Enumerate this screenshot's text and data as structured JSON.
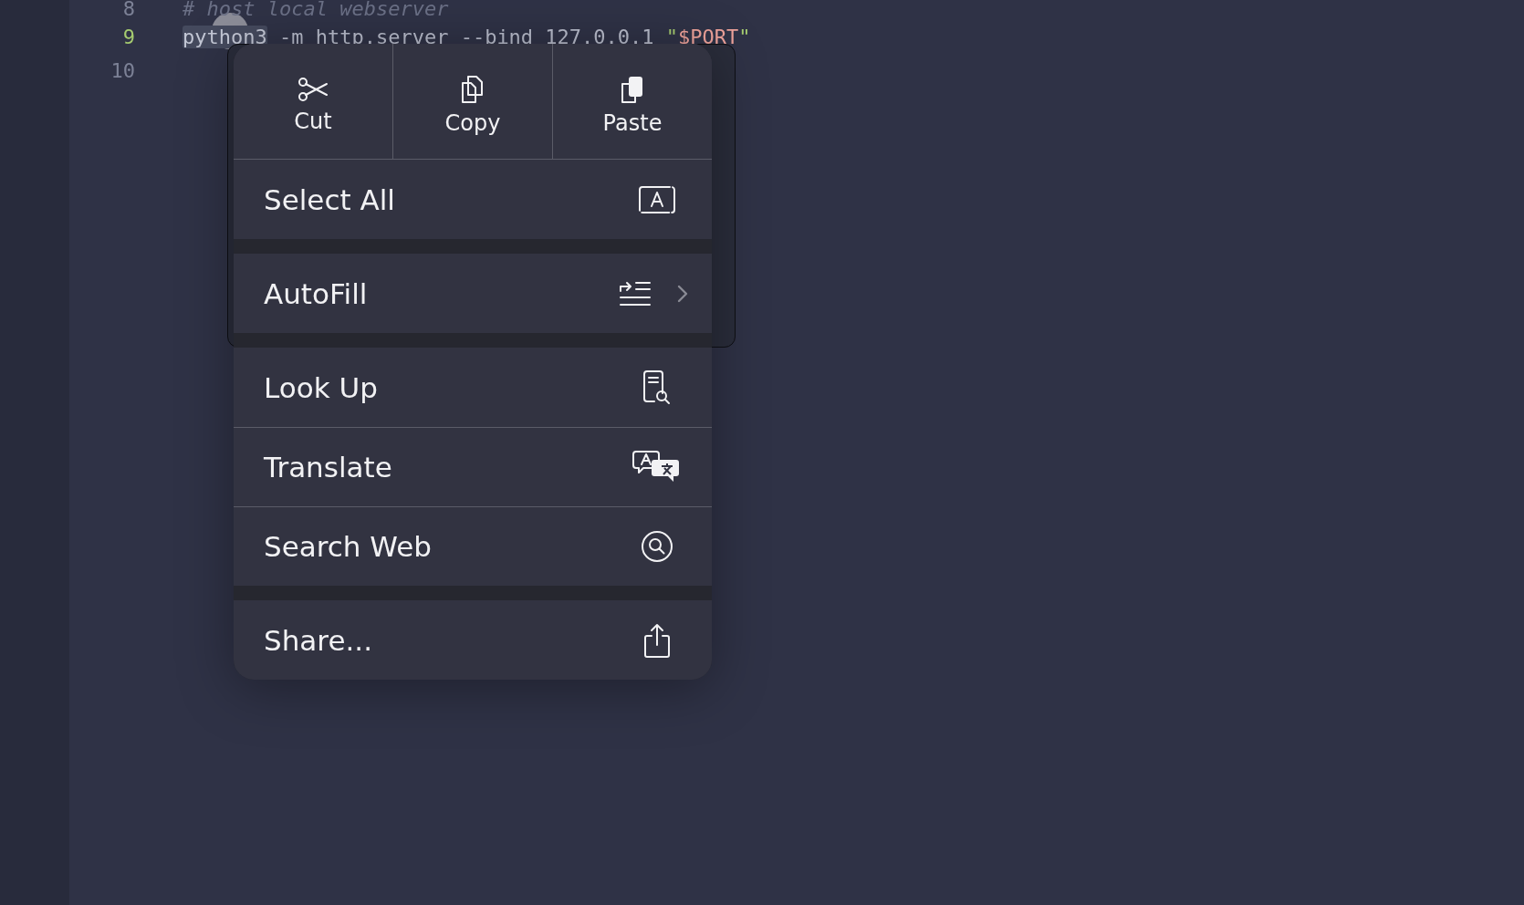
{
  "editor": {
    "lines": [
      {
        "number": "8",
        "current": false,
        "tokens": [
          {
            "kind": "comment",
            "text": "# host local webserver"
          }
        ]
      },
      {
        "number": "9",
        "current": true,
        "tokens": [
          {
            "kind": "selected",
            "text": "python3"
          },
          {
            "kind": "plain",
            "text": " -m http.server --bind 127.0.0.1 "
          },
          {
            "kind": "string",
            "text": "\""
          },
          {
            "kind": "variable",
            "text": "$PORT"
          },
          {
            "kind": "string",
            "text": "\""
          }
        ]
      },
      {
        "number": "10",
        "current": false
      }
    ]
  },
  "context_menu": {
    "actions": [
      {
        "label": "Cut"
      },
      {
        "label": "Copy"
      },
      {
        "label": "Paste"
      }
    ],
    "sections": [
      [
        {
          "label": "Select All",
          "submenu": false
        }
      ],
      [
        {
          "label": "AutoFill",
          "submenu": true
        }
      ],
      [
        {
          "label": "Look Up",
          "submenu": false
        },
        {
          "label": "Translate",
          "submenu": false
        },
        {
          "label": "Search Web",
          "submenu": false
        }
      ],
      [
        {
          "label": "Share...",
          "submenu": false
        }
      ]
    ]
  }
}
